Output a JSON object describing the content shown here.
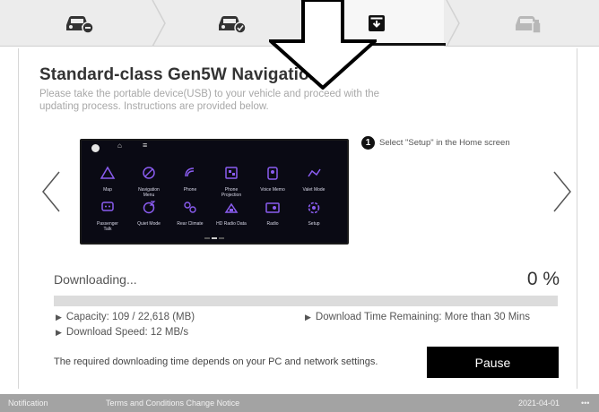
{
  "steps": [
    {
      "icon": "car-remove-icon",
      "state": "done"
    },
    {
      "icon": "car-check-icon",
      "state": "done"
    },
    {
      "icon": "download-box-icon",
      "state": "active"
    },
    {
      "icon": "car-usb-icon",
      "state": "pending"
    }
  ],
  "main": {
    "title": "Standard-class Gen5W Navigation",
    "subtitle": "Please take the portable device(USB) to your vehicle and proceed with the updating process. Instructions are provided below."
  },
  "instruction": {
    "number": "1",
    "text": "Select \"Setup\" in the Home screen"
  },
  "device_screen": {
    "apps": [
      {
        "label": "Map",
        "icon": "map-icon"
      },
      {
        "label": "Navigation\nMenu",
        "icon": "navigation-menu-icon"
      },
      {
        "label": "Phone",
        "icon": "phone-icon"
      },
      {
        "label": "Phone\nProjection",
        "icon": "phone-projection-icon"
      },
      {
        "label": "Voice Memo",
        "icon": "voice-memo-icon"
      },
      {
        "label": "Valet Mode",
        "icon": "valet-mode-icon"
      },
      {
        "label": "Passenger\nTalk",
        "icon": "passenger-talk-icon"
      },
      {
        "label": "Quiet Mode",
        "icon": "quiet-mode-icon"
      },
      {
        "label": "Rear Climate",
        "icon": "rear-climate-icon"
      },
      {
        "label": "HD Radio Data",
        "icon": "hd-radio-data-icon"
      },
      {
        "label": "Radio",
        "icon": "radio-icon"
      },
      {
        "label": "Setup",
        "icon": "setup-icon"
      }
    ]
  },
  "download": {
    "status_label": "Downloading...",
    "percent_text": "0 %",
    "progress_fraction": 0,
    "capacity": "Capacity: 109 / 22,618 (MB)",
    "time_remaining": "Download Time Remaining: More than 30 Mins",
    "speed": "Download Speed: 12 MB/s",
    "note": "The required downloading time depends on your PC and network settings.",
    "pause_label": "Pause"
  },
  "footer": {
    "notification": "Notification",
    "terms": "Terms and Conditions Change Notice",
    "date": "2021-04-01",
    "more": "•••"
  },
  "colors": {
    "accent": "#000000",
    "progress_fill": "#002c5f",
    "icon_purple": "#8a5cf0",
    "footer_bg": "#a3a3a3"
  }
}
